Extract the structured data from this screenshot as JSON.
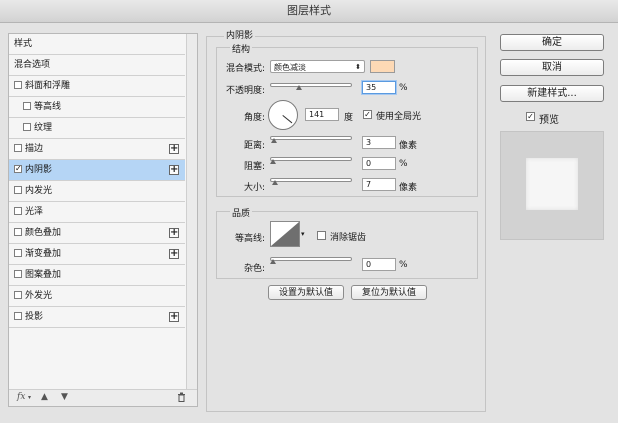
{
  "window": {
    "title": "图层样式"
  },
  "left_list": {
    "items": [
      {
        "label": "样式",
        "checkbox": false,
        "checked": false,
        "plus": false,
        "indent": false,
        "selected": false
      },
      {
        "label": "混合选项",
        "checkbox": false,
        "checked": false,
        "plus": false,
        "indent": false,
        "selected": false
      },
      {
        "label": "斜面和浮雕",
        "checkbox": true,
        "checked": false,
        "plus": false,
        "indent": false,
        "selected": false
      },
      {
        "label": "等高线",
        "checkbox": true,
        "checked": false,
        "plus": false,
        "indent": true,
        "selected": false
      },
      {
        "label": "纹理",
        "checkbox": true,
        "checked": false,
        "plus": false,
        "indent": true,
        "selected": false
      },
      {
        "label": "描边",
        "checkbox": true,
        "checked": false,
        "plus": true,
        "indent": false,
        "selected": false
      },
      {
        "label": "内阴影",
        "checkbox": true,
        "checked": true,
        "plus": true,
        "indent": false,
        "selected": true
      },
      {
        "label": "内发光",
        "checkbox": true,
        "checked": false,
        "plus": false,
        "indent": false,
        "selected": false
      },
      {
        "label": "光泽",
        "checkbox": true,
        "checked": false,
        "plus": false,
        "indent": false,
        "selected": false
      },
      {
        "label": "颜色叠加",
        "checkbox": true,
        "checked": false,
        "plus": true,
        "indent": false,
        "selected": false
      },
      {
        "label": "渐变叠加",
        "checkbox": true,
        "checked": false,
        "plus": true,
        "indent": false,
        "selected": false
      },
      {
        "label": "图案叠加",
        "checkbox": true,
        "checked": false,
        "plus": false,
        "indent": false,
        "selected": false
      },
      {
        "label": "外发光",
        "checkbox": true,
        "checked": false,
        "plus": false,
        "indent": false,
        "selected": false
      },
      {
        "label": "投影",
        "checkbox": true,
        "checked": false,
        "plus": true,
        "indent": false,
        "selected": false
      }
    ],
    "footer": {
      "fx": "fx",
      "up_icon": "arrow-up-icon",
      "down_icon": "arrow-down-icon",
      "trash_icon": "trash-icon"
    }
  },
  "inner_shadow": {
    "section_title": "内阴影",
    "structure": {
      "title": "结构",
      "blend_mode_label": "混合模式:",
      "blend_mode_value": "颜色减淡",
      "color": "#fdd9b5",
      "opacity_label": "不透明度:",
      "opacity_value": "35",
      "opacity_unit": "%",
      "opacity_fraction": 0.35,
      "angle_label": "角度:",
      "angle_value": "141",
      "angle_unit": "度",
      "global_light_label": "使用全局光",
      "global_light_checked": true,
      "distance_label": "距离:",
      "distance_value": "3",
      "distance_unit": "像素",
      "distance_fraction": 0.015,
      "choke_label": "阻塞:",
      "choke_value": "0",
      "choke_unit": "%",
      "choke_fraction": 0.0,
      "size_label": "大小:",
      "size_value": "7",
      "size_unit": "像素",
      "size_fraction": 0.028
    },
    "quality": {
      "title": "品质",
      "contour_label": "等高线:",
      "antialias_label": "消除锯齿",
      "antialias_checked": false,
      "noise_label": "杂色:",
      "noise_value": "0",
      "noise_unit": "%",
      "noise_fraction": 0.0
    },
    "set_default_label": "设置为默认值",
    "reset_default_label": "复位为默认值"
  },
  "right": {
    "ok_label": "确定",
    "cancel_label": "取消",
    "new_style_label": "新建样式...",
    "preview_label": "预览",
    "preview_checked": true
  }
}
